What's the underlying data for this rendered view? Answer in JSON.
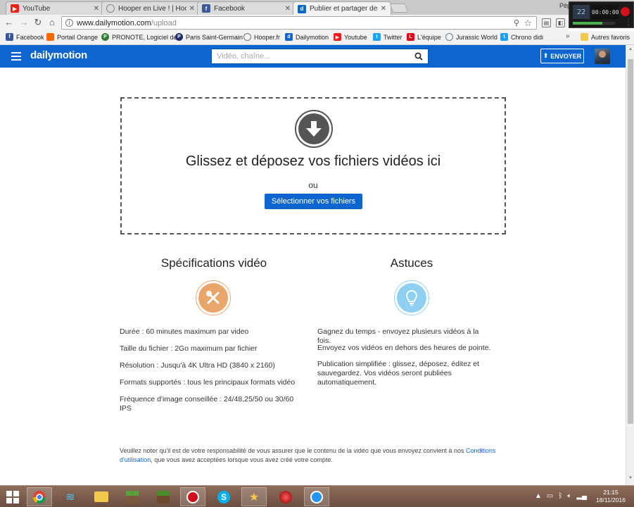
{
  "browser": {
    "tabs": [
      {
        "label": "YouTube",
        "icon": "youtube-icon",
        "active": false
      },
      {
        "label": "Hooper en Live ! | Hoope",
        "icon": "globe-icon",
        "active": false
      },
      {
        "label": "Facebook",
        "icon": "facebook-icon",
        "active": false
      },
      {
        "label": "Publier et partager des v",
        "icon": "dailymotion-icon",
        "active": true
      }
    ],
    "profile_label": "Pép",
    "url_host": "www.dailymotion.com",
    "url_path": "/upload",
    "bookmarks": [
      {
        "label": "Facebook",
        "icon": "facebook-icon",
        "color": "#3b5998",
        "glyph": "f"
      },
      {
        "label": "Portail Orange",
        "icon": "orange-icon",
        "color": "#ff6600",
        "glyph": ""
      },
      {
        "label": "PRONOTE, Logiciel de",
        "icon": "pronote-icon",
        "color": "#2e7d32",
        "glyph": "P"
      },
      {
        "label": "Paris Saint-Germain",
        "icon": "psg-icon",
        "color": "#1a2a6c",
        "glyph": "P"
      },
      {
        "label": "Hooper.fr",
        "icon": "globe-icon",
        "color": "#ffffff",
        "glyph": ""
      },
      {
        "label": "Dailymotion",
        "icon": "dailymotion-icon",
        "color": "#0d66d0",
        "glyph": "d"
      },
      {
        "label": "Youtube",
        "icon": "youtube-icon",
        "color": "#e62117",
        "glyph": "▶"
      },
      {
        "label": "Twitter",
        "icon": "twitter-icon",
        "color": "#1da1f2",
        "glyph": "t"
      },
      {
        "label": "L'équipe",
        "icon": "lequipe-icon",
        "color": "#e2001a",
        "glyph": "L"
      },
      {
        "label": "Jurassic World",
        "icon": "globe-icon",
        "color": "#607d8b",
        "glyph": ""
      },
      {
        "label": "Chrono didi",
        "icon": "twitter-icon",
        "color": "#1da1f2",
        "glyph": "t"
      }
    ],
    "bookmarks_more": "»",
    "other_bookmarks": "Autres favoris"
  },
  "recorder": {
    "fps": "22",
    "time": "00:00:00",
    "fps_label": "FPS"
  },
  "header": {
    "logo": "dailymotion",
    "search_placeholder": "Vidéo, chaîne...",
    "upload_label": "ENVOYER"
  },
  "dropzone": {
    "title": "Glissez et déposez vos fichiers vidéos ici",
    "or": "ou",
    "select_button": "Sélectionner vos fichiers"
  },
  "specs": {
    "title": "Spécifications vidéo",
    "lines": [
      "Durée : 60 minutes maximum par video",
      "Taille du fichier : 2Go maximum par fichier",
      "Résolution : Jusqu'à 4K Ultra HD (3840 x 2160)",
      "Formats supportés : tous les principaux formats vidéo",
      "Fréquence d'image conseillée : 24/48,25/50 ou 30/60 IPS"
    ]
  },
  "tips": {
    "title": "Astuces",
    "lines": [
      "Gagnez du temps - envoyez plusieurs vidéos à la fois.",
      "Envoyez vos vidéos en dehors des heures de pointe.",
      "Publication simplifiée : glissez, déposez, éditez et sauvegardez. Vos vidéos seront publiées automatiquement."
    ]
  },
  "legal": {
    "text_before": "Veuillez noter qu'il est de votre responsabilité de vous assurer que le contenu de la vidéo que vous envoyez convient à nos ",
    "link": "Conditions d'utilisation",
    "text_after": ", que vous avez acceptées lorsque vous avez créé votre compte."
  },
  "taskbar": {
    "time": "21:15",
    "date": "18/11/2016"
  },
  "colors": {
    "brand": "#0d66d0",
    "spec_icon": "#e8a66b",
    "tip_icon": "#8fd0f0"
  }
}
